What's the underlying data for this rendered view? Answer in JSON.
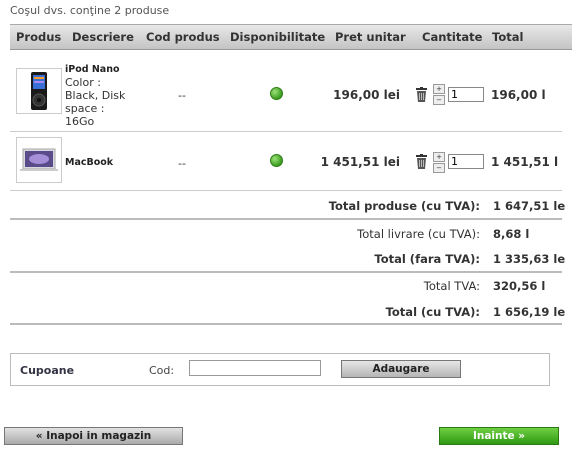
{
  "cart": {
    "summary": "Coşul dvs. conţine 2 produse",
    "columns": [
      "Produs",
      "Descriere",
      "Cod produs",
      "Disponibilitate",
      "Pret unitar",
      "Cantitate",
      "Total"
    ],
    "items": [
      {
        "name": "iPod Nano",
        "attributes": [
          "Color :",
          "Black, Disk",
          "space :",
          "16Go"
        ],
        "code": "--",
        "availability": "in-stock",
        "unit_price": "196,00 lei",
        "quantity": "1",
        "total": "196,00 l",
        "thumbnail_icon": "ipod-nano-image"
      },
      {
        "name": "MacBook",
        "attributes": [],
        "code": "--",
        "availability": "in-stock",
        "unit_price": "1 451,51 lei",
        "quantity": "1",
        "total": "1 451,51 l",
        "thumbnail_icon": "macbook-image"
      }
    ],
    "totals": [
      {
        "label": "Total produse (cu TVA):",
        "value": "1 647,51 le",
        "bold": true
      },
      {
        "label": "Total livrare (cu TVA):",
        "value": "8,68 l",
        "bold": false
      },
      {
        "label": "Total (fara TVA):",
        "value": "1 335,63 le",
        "bold": true
      },
      {
        "label": "Total TVA:",
        "value": "320,56 l",
        "bold": false
      },
      {
        "label": "Total (cu TVA):",
        "value": "1 656,19 le",
        "bold": true
      }
    ]
  },
  "coupon": {
    "title": "Cupoane",
    "code_label": "Cod:",
    "code_value": "",
    "add_label": "Adaugare"
  },
  "nav": {
    "back_label": "« Inapoi in magazin",
    "next_label": "Inainte »"
  },
  "colors": {
    "available": "#4caf2a",
    "next_button": "#3aa318"
  }
}
